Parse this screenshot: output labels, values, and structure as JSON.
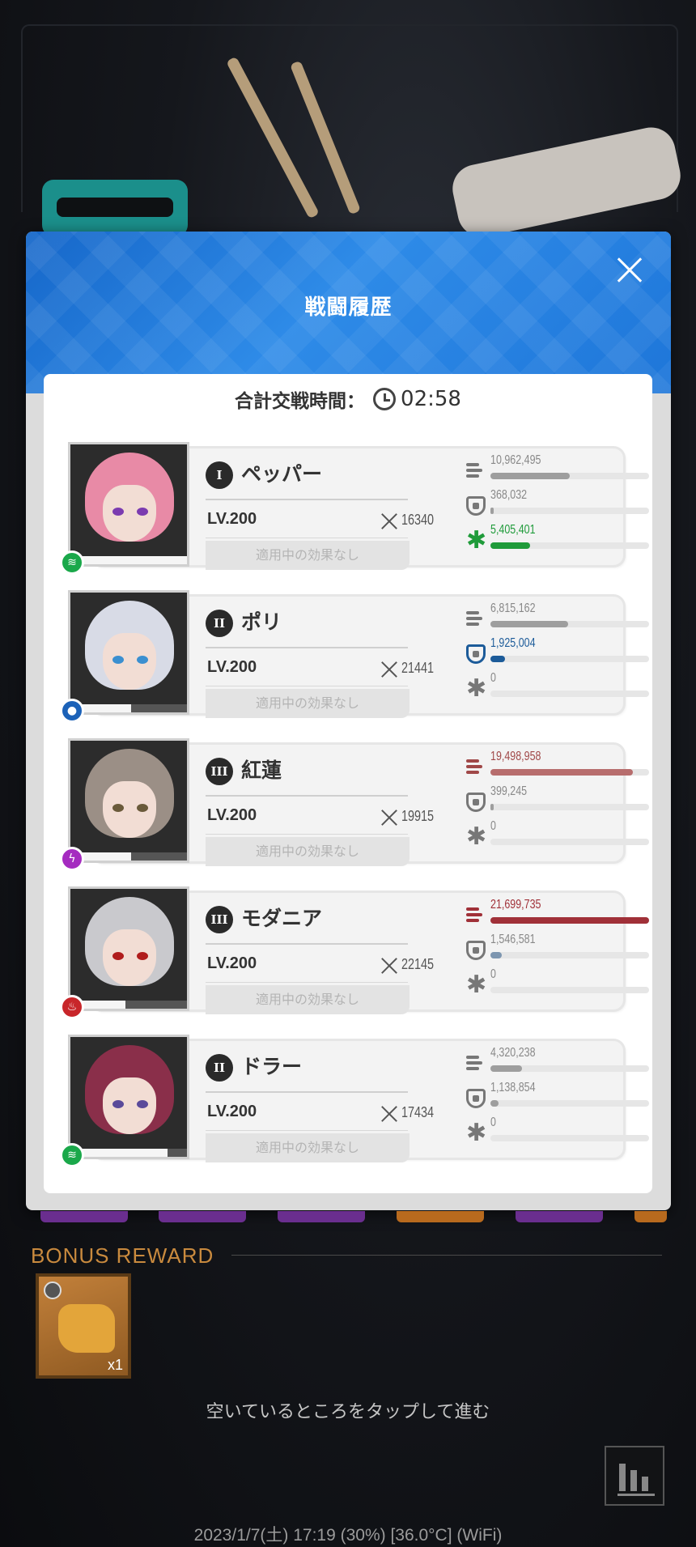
{
  "modal": {
    "title": "戦闘履歴",
    "total_time_label": "合計交戦時間：",
    "total_time_value": "02:58"
  },
  "characters": [
    {
      "burst": "I",
      "name": "ペッパー",
      "level": "LV.200",
      "power": "16340",
      "effect": "適用中の効果なし",
      "element": "wind",
      "element_color": "#1aa84a",
      "hp_fraction": 0.98,
      "damage": "10,962,495",
      "damage_fraction": 0.5,
      "damage_color": "#9e9e9e",
      "shield": "368,032",
      "shield_fraction": 0.02,
      "shield_color": "#9e9e9e",
      "heal": "5,405,401",
      "heal_fraction": 0.25,
      "heal_color": "#1f9b3a",
      "heal_text_color": "#1f9b3a"
    },
    {
      "burst": "II",
      "name": "ポリ",
      "level": "LV.200",
      "power": "21441",
      "effect": "適用中の効果なし",
      "element": "water",
      "element_color": "#1c62b8",
      "hp_fraction": 0.5,
      "damage": "6,815,162",
      "damage_fraction": 0.49,
      "damage_color": "#9e9e9e",
      "shield": "1,925,004",
      "shield_fraction": 0.09,
      "shield_color": "#1c5b99",
      "shield_text_color": "#1c5b99",
      "heal": "0",
      "heal_fraction": 0,
      "heal_color": "#9e9e9e"
    },
    {
      "burst": "III",
      "name": "紅蓮",
      "level": "LV.200",
      "power": "19915",
      "effect": "適用中の効果なし",
      "element": "electric",
      "element_color": "#a52bc0",
      "hp_fraction": 0.5,
      "damage": "19,498,958",
      "damage_fraction": 0.9,
      "damage_color": "#b76d6d",
      "damage_text_color": "#a04848",
      "shield": "399,245",
      "shield_fraction": 0.02,
      "shield_color": "#9e9e9e",
      "heal": "0",
      "heal_fraction": 0,
      "heal_color": "#9e9e9e"
    },
    {
      "burst": "III",
      "name": "モダニア",
      "level": "LV.200",
      "power": "22145",
      "effect": "適用中の効果なし",
      "element": "fire",
      "element_color": "#c8262a",
      "hp_fraction": 0.45,
      "damage": "21,699,735",
      "damage_fraction": 1.0,
      "damage_color": "#a03038",
      "damage_text_color": "#a03038",
      "shield": "1,546,581",
      "shield_fraction": 0.07,
      "shield_color": "#7d96b0",
      "heal": "0",
      "heal_fraction": 0,
      "heal_color": "#9e9e9e"
    },
    {
      "burst": "II",
      "name": "ドラー",
      "level": "LV.200",
      "power": "17434",
      "effect": "適用中の効果なし",
      "element": "wind",
      "element_color": "#1aa84a",
      "hp_fraction": 0.8,
      "damage": "4,320,238",
      "damage_fraction": 0.2,
      "damage_color": "#9e9e9e",
      "shield": "1,138,854",
      "shield_fraction": 0.05,
      "shield_color": "#9e9e9e",
      "heal": "0",
      "heal_fraction": 0,
      "heal_color": "#9e9e9e"
    }
  ],
  "bonus": {
    "title": "BONUS REWARD",
    "reward_qty": "x1"
  },
  "tap_hint": "空いているところをタップして進む",
  "status_bar": "2023/1/7(土) 17:19 (30%) [36.0°C] (WiFi)"
}
